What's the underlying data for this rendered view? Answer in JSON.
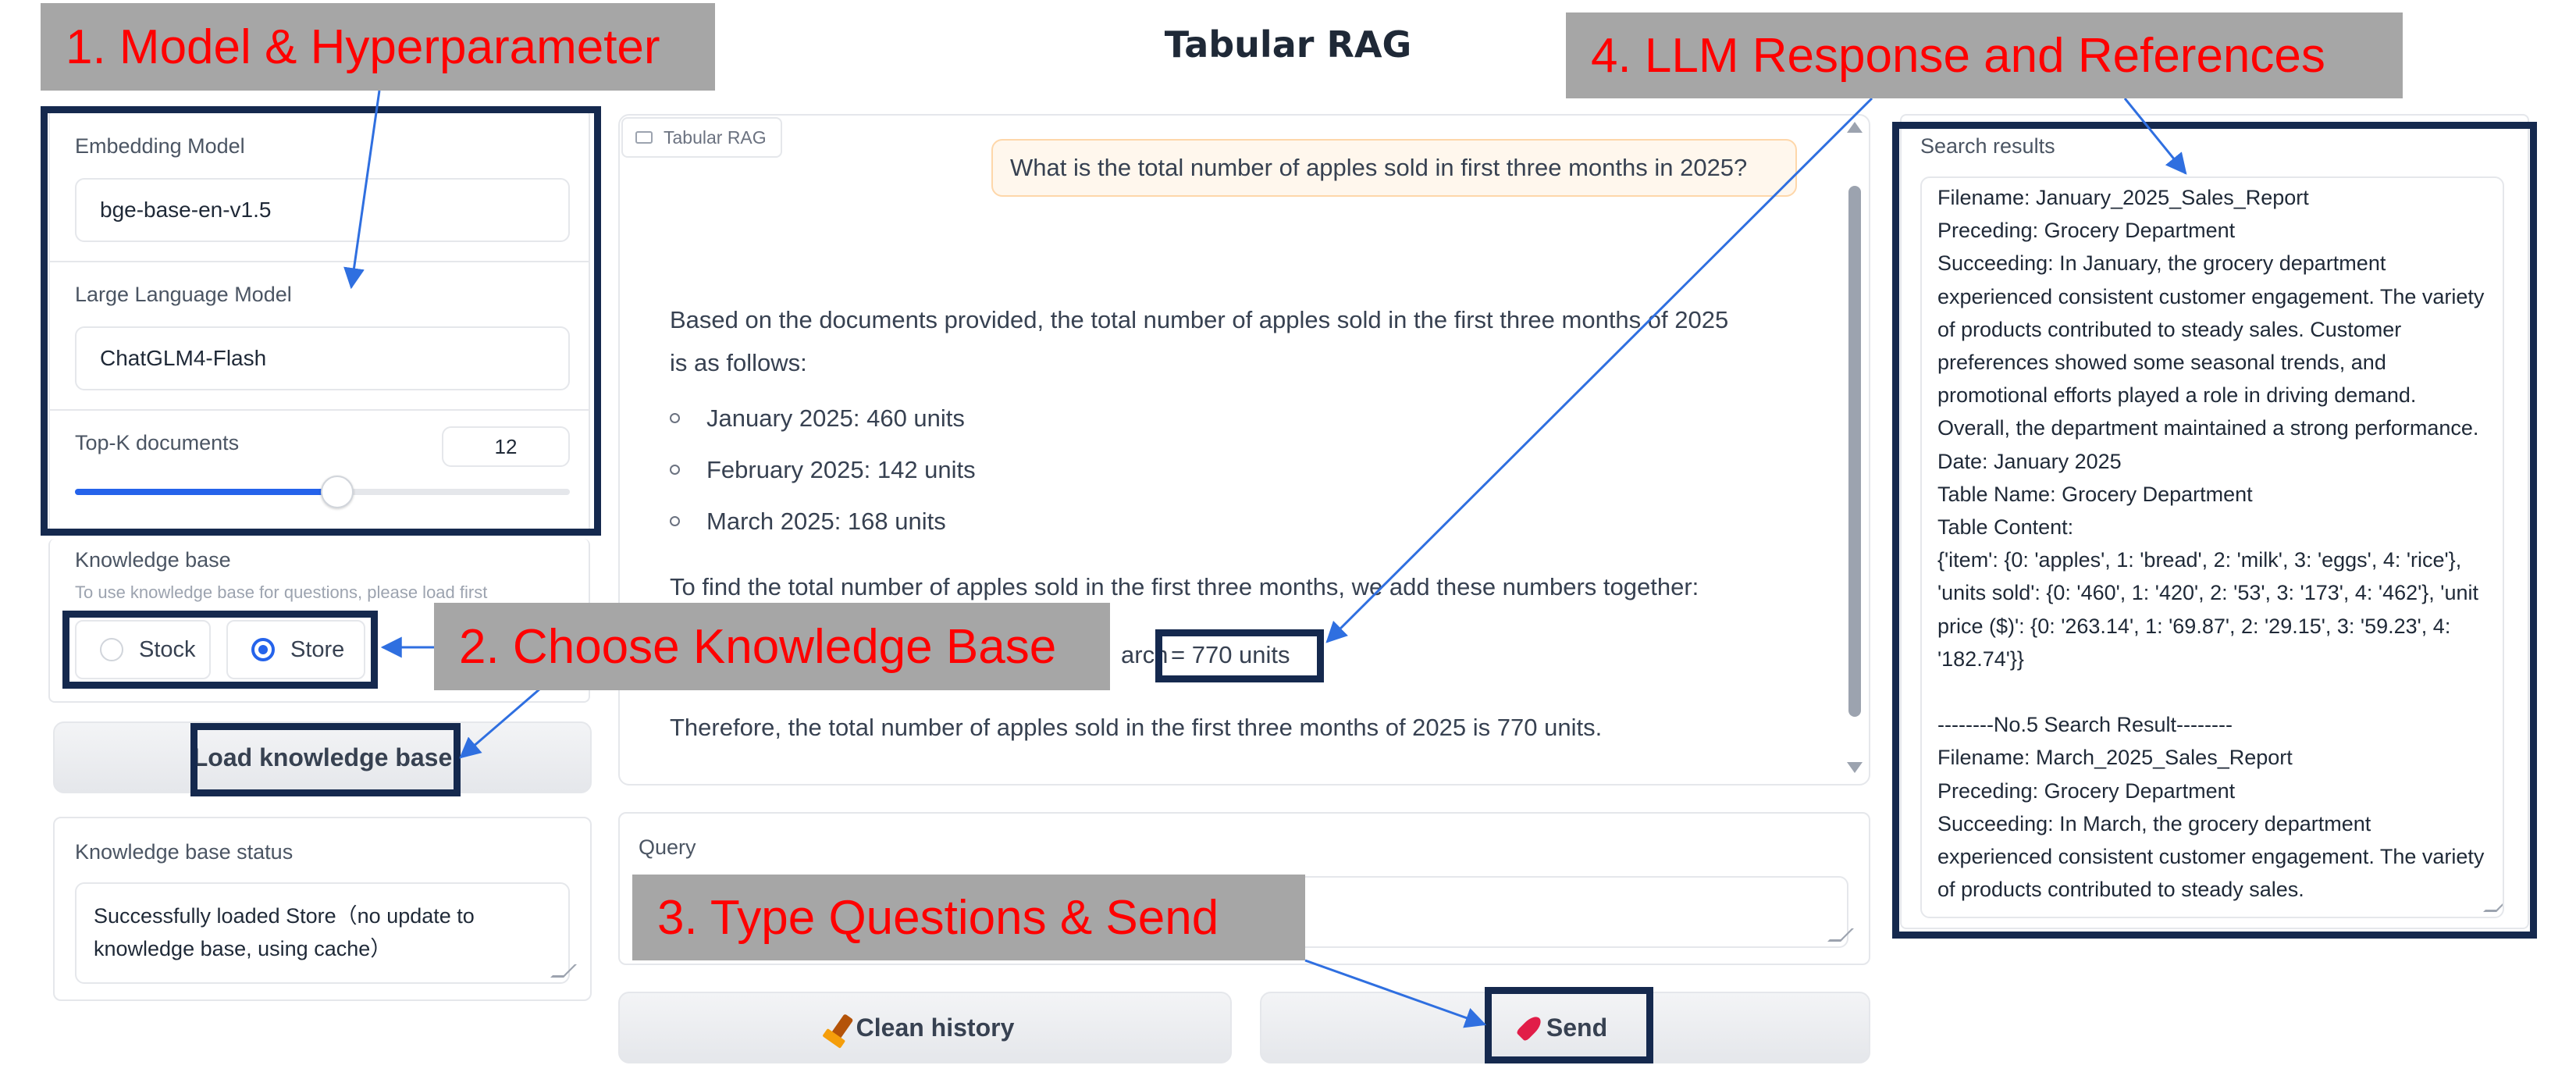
{
  "app": {
    "title": "Tabular RAG"
  },
  "callouts": {
    "c1": "1. Model & Hyperparameter",
    "c2": "2. Choose Knowledge Base",
    "c3": "3. Type Questions & Send",
    "c4": "4. LLM Response and References"
  },
  "settings": {
    "embedding_label": "Embedding Model",
    "embedding_value": "bge-base-en-v1.5",
    "llm_label": "Large Language Model",
    "llm_value": "ChatGLM4-Flash",
    "topk_label": "Top-K documents",
    "topk_value": "12",
    "topk_fraction": 0.53
  },
  "knowledge": {
    "label": "Knowledge base",
    "hint": "To use knowledge base for questions, please load first",
    "options": [
      {
        "label": "Stock",
        "selected": false
      },
      {
        "label": "Store",
        "selected": true
      }
    ],
    "load_button": "Load knowledge base",
    "status_label": "Knowledge base status",
    "status_line1": "Successfully loaded Store（no update to",
    "status_line2": "knowledge base, using cache）"
  },
  "chat": {
    "tab_label": "Tabular RAG",
    "user_message": "What is the total number of apples sold in first three months in 2025?",
    "answer_line1": "Based on the documents provided, the total number of apples sold in the first three months of 2025",
    "answer_line2": "is as follows:",
    "bullets": [
      "January 2025: 460 units",
      "February 2025: 142 units",
      "March 2025: 168 units"
    ],
    "sum_intro": "To find the total number of apples sold in the first three months, we add these numbers together:",
    "sum_fragment": "arch",
    "sum_result": "= 770 units",
    "conclusion": "Therefore, the total number of apples sold in the first three months of 2025 is 770 units."
  },
  "query": {
    "label": "Query",
    "value": ""
  },
  "buttons": {
    "clean": "Clean history",
    "send": "Send",
    "clean_icon": "broom-icon",
    "send_icon": "rocket-icon"
  },
  "search": {
    "label": "Search results",
    "text": "Filename: January_2025_Sales_Report\nPreceding: Grocery Department\nSucceeding: In January, the grocery department experienced consistent customer engagement. The variety of products contributed to steady sales. Customer preferences showed some seasonal trends, and promotional efforts played a role in driving demand. Overall, the department maintained a strong performance.\nDate: January 2025\nTable Name: Grocery Department\nTable Content:\n{'item': {0: 'apples', 1: 'bread', 2: 'milk', 3: 'eggs', 4: 'rice'}, 'units sold': {0: '460', 1: '420', 2: '53', 3: '173', 4: '462'}, 'unit price ($)': {0: '263.14', 1: '69.87', 2: '29.15', 3: '59.23', 4: '182.74'}}\n\n--------No.5 Search Result--------\nFilename: March_2025_Sales_Report\nPreceding: Grocery Department\nSucceeding: In March, the grocery department experienced consistent customer engagement. The variety of products contributed to steady sales."
  },
  "colors": {
    "annotation_red": "#ff0000",
    "callout_gray": "#a6a6a6",
    "frame_navy": "#15294e",
    "arrow_blue": "#2f6fe0",
    "accent_blue": "#2563eb"
  }
}
